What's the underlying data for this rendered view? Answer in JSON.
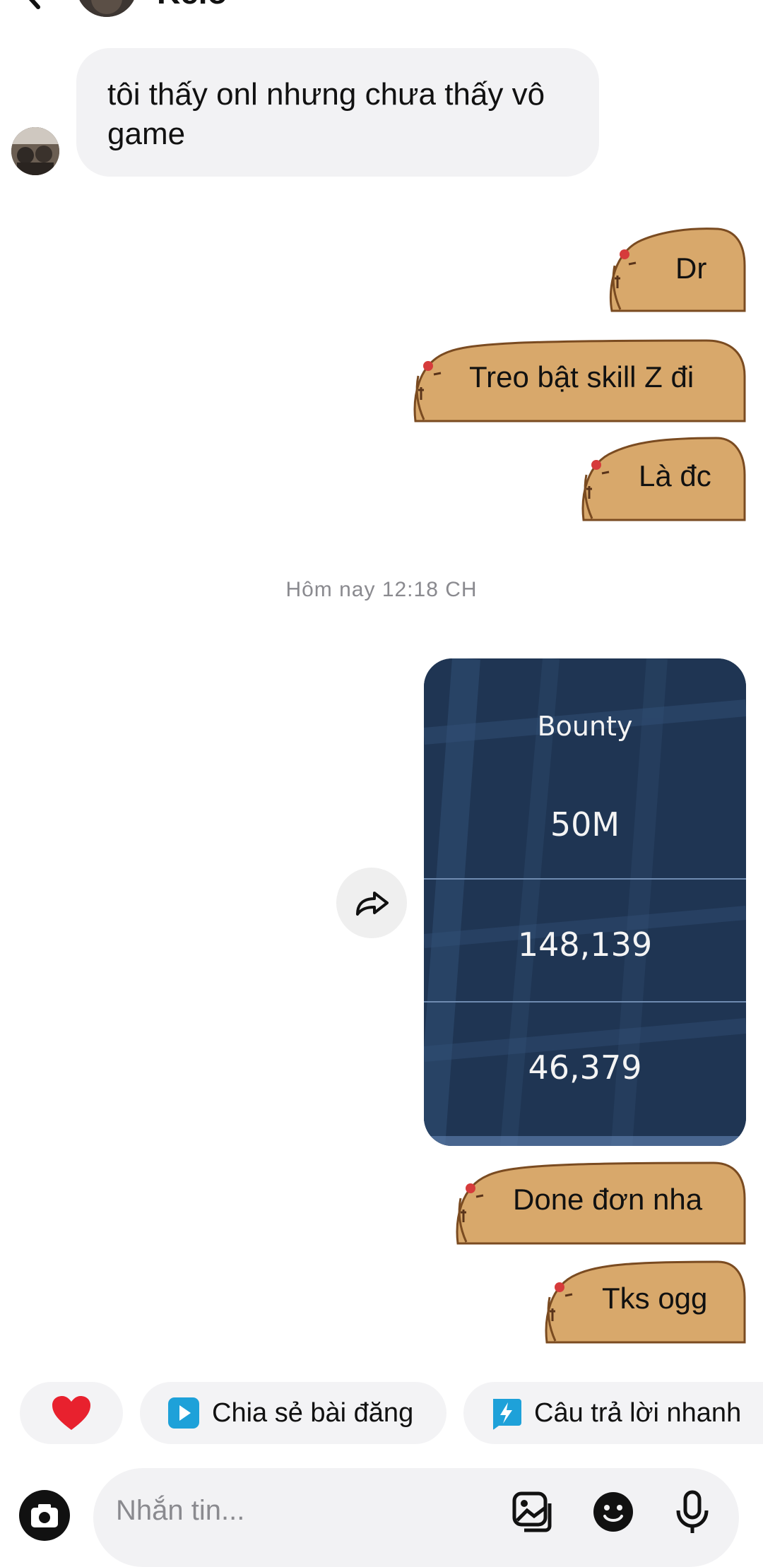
{
  "header": {
    "contact_name": "Kelo",
    "back_icon": "back-arrow-icon",
    "call_icon": "star-icon"
  },
  "messages": {
    "incoming_1": "tôi thấy onl nhưng chưa thấy vô game",
    "outgoing_1": "Dr",
    "outgoing_2": "Treo bật skill Z đi",
    "outgoing_3": "Là đc",
    "timestamp": "Hôm nay 12:18 CH",
    "image": {
      "title": "Bounty",
      "row_1": "50M",
      "row_2": "148,139",
      "row_3": "46,379"
    },
    "outgoing_4": "Done đơn nha",
    "outgoing_5": "Tks ogg"
  },
  "quick_actions": {
    "heart_icon": "heart-icon",
    "share_post": "Chia sẻ bài đăng",
    "quick_reply": "Câu trả lời nhanh"
  },
  "composer": {
    "placeholder": "Nhắn tin...",
    "camera_icon": "camera-icon",
    "gallery_icon": "gallery-icon",
    "sticker_icon": "sticker-icon",
    "mic_icon": "microphone-icon"
  },
  "colors": {
    "sticker_body": "#d8a86b",
    "sticker_outline": "#7a4b21",
    "incoming_bubble": "#f2f2f4",
    "accent_blue": "#1ea1d9",
    "heart_red": "#e8212e",
    "image_bg": "#1f3553"
  }
}
